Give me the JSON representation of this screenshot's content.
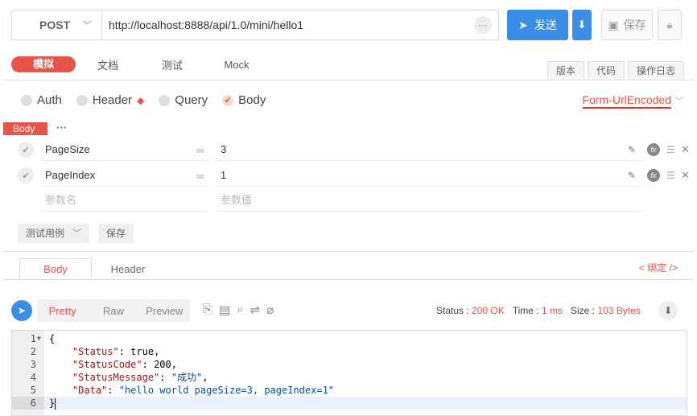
{
  "request": {
    "method": "POST",
    "url": "http://localhost:8888/api/1.0/mini/hello1",
    "send_label": "发送",
    "save_label": "保存"
  },
  "tabs": [
    "模拟",
    "文档",
    "测试",
    "Mock"
  ],
  "right_tabs": [
    "版本",
    "代码",
    "操作日志"
  ],
  "body_types": [
    "Auth",
    "Header",
    "Query",
    "Body"
  ],
  "selected_body_type": "Body",
  "encoding": "Form-UrlEncoded",
  "body_label": "Body",
  "params": [
    {
      "name": "PageSize",
      "value": "3"
    },
    {
      "name": "PageIndex",
      "value": "1"
    }
  ],
  "param_placeholders": {
    "name": "参数名",
    "value": "参数值"
  },
  "test_case_label": "测试用例",
  "save_label": "保存",
  "response": {
    "tabs": [
      "Body",
      "Header"
    ],
    "bind_label": "< 绑定 />",
    "views": [
      "Pretty",
      "Raw",
      "Preview"
    ],
    "status_label": "Status :",
    "status_value": "200 OK",
    "time_label": "Time :",
    "time_value": "1 ms",
    "size_label": "Size :",
    "size_value": "103 Bytes",
    "code_lines": [
      {
        "n": "1",
        "t": "{"
      },
      {
        "n": "2",
        "key": "\"Status\"",
        "val": "true",
        "type": "n"
      },
      {
        "n": "3",
        "key": "\"StatusCode\"",
        "val": "200",
        "type": "n"
      },
      {
        "n": "4",
        "key": "\"StatusMessage\"",
        "val": "\"成功\"",
        "type": "s"
      },
      {
        "n": "5",
        "key": "\"Data\"",
        "val": "\"hello world pageSize=3, pageIndex=1\"",
        "type": "s"
      },
      {
        "n": "6",
        "t": "}"
      }
    ]
  },
  "colors": {
    "accent": "#e8544a",
    "primary": "#3a8ee6"
  }
}
